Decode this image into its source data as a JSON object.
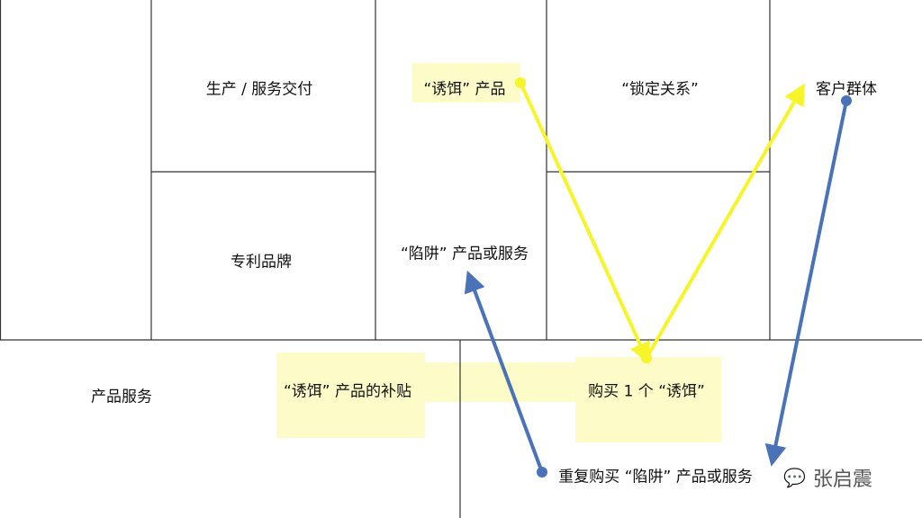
{
  "cells": {
    "production": "生产 / 服务交付",
    "patent_brand": "专利品牌",
    "bait_product": "“诱饵” 产品",
    "trap_product": "“陷阱” 产品或服务",
    "lock_relationship": "“锁定关系”",
    "customer_segment": "客户群体",
    "product_service": "产品服务",
    "bait_subsidy": "“诱饵” 产品的补贴",
    "buy_one_bait": "购买 1 个 “诱饵”",
    "repeat_purchase": "重复购买 “陷阱” 产品或服务"
  },
  "watermark": "张启震",
  "colors": {
    "yellow_arrow": "#f5f52a",
    "blue_arrow": "#4a72b8",
    "highlight": "#fdfbc8"
  }
}
